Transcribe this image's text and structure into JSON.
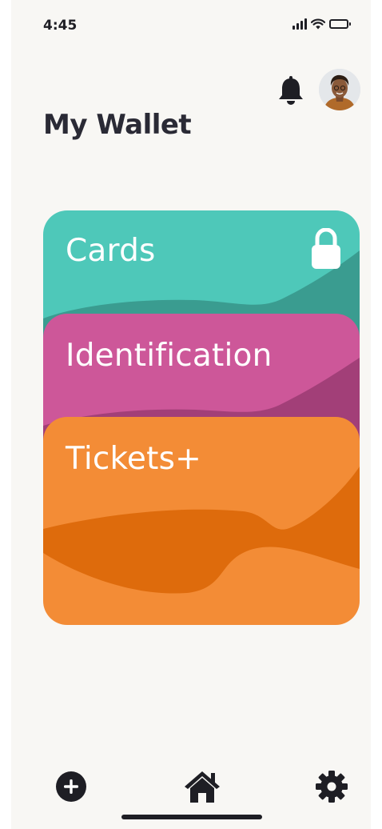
{
  "status_bar": {
    "time": "4:45",
    "icons": [
      "cellular-signal-icon",
      "wifi-icon",
      "battery-icon"
    ]
  },
  "header": {
    "title": "My Wallet",
    "notification_icon": "bell-icon",
    "avatar": "user-avatar"
  },
  "cards": [
    {
      "label": "Cards",
      "color": "#4ec8b9",
      "wave_color": "#3a9c90",
      "icon": "lock-icon"
    },
    {
      "label": "Identification",
      "color": "#cd5799",
      "wave_color": "#a23f78"
    },
    {
      "label": "Tickets+",
      "color": "#f38c36",
      "wave_color": "#de6b0c"
    }
  ],
  "bottom_nav": {
    "items": [
      {
        "name": "add",
        "icon": "plus-circle-icon"
      },
      {
        "name": "home",
        "icon": "home-icon"
      },
      {
        "name": "settings",
        "icon": "gear-icon"
      }
    ]
  },
  "colors": {
    "background": "#f8f7f4",
    "text": "#2a2a35",
    "icon": "#1e1e24"
  }
}
